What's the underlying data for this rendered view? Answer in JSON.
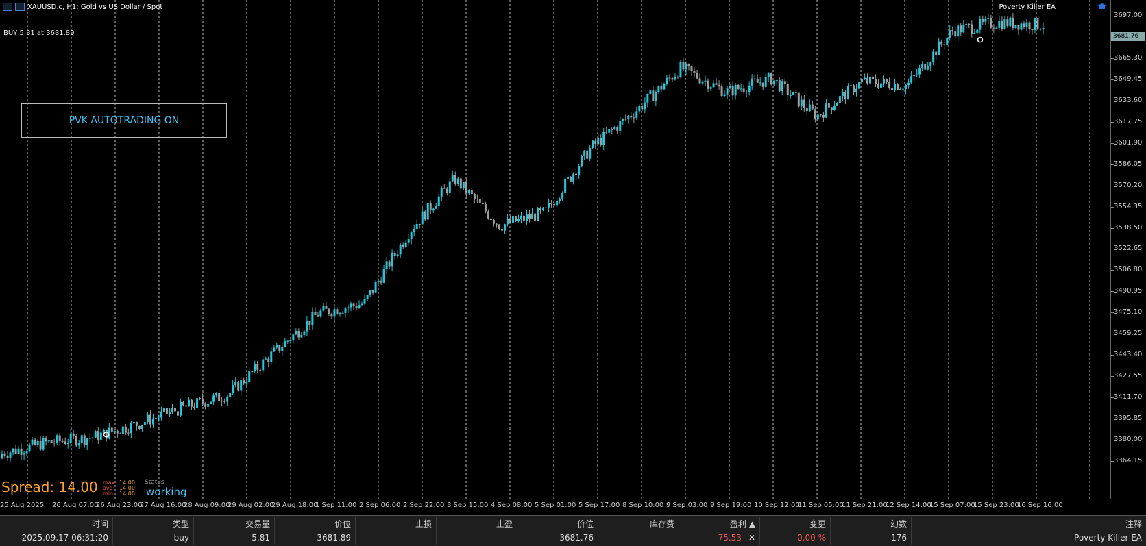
{
  "window": {
    "title": "XAUUSD.c, H1:  Gold vs US Dollar / Spot",
    "ea_name": "Poverty Killer EA"
  },
  "position_line": {
    "label": "BUY 5.81 at 3681.89"
  },
  "panel": {
    "autotrading": "PVK AUTOTRADING ON"
  },
  "current_price": "3681.76",
  "spread": {
    "label": "Spread: 14.00",
    "max_label": "max:",
    "max_value": "14.00",
    "avg_label": "avg:",
    "avg_value": "14.00",
    "min_label": "min:",
    "min_value": "14.00",
    "status_label": "Status",
    "status_value": "working"
  },
  "price_axis": [
    "3697.00",
    "3681.76",
    "3665.30",
    "3649.45",
    "3633.60",
    "3617.75",
    "3601.90",
    "3586.05",
    "3570.20",
    "3554.35",
    "3538.50",
    "3522.65",
    "3506.80",
    "3490.95",
    "3475.10",
    "3459.25",
    "3443.40",
    "3427.55",
    "3411.70",
    "3395.85",
    "3380.00",
    "3364.15"
  ],
  "time_axis": [
    "25 Aug 2025",
    "26 Aug 07:00",
    "26 Aug 23:00",
    "27 Aug 16:00",
    "28 Aug 09:00",
    "29 Aug 02:00",
    "29 Aug 18:00",
    "1 Sep 11:00",
    "2 Sep 06:00",
    "2 Sep 22:00",
    "3 Sep 15:00",
    "4 Sep 08:00",
    "5 Sep 01:00",
    "5 Sep 17:00",
    "8 Sep 10:00",
    "9 Sep 03:00",
    "9 Sep 19:00",
    "10 Sep 12:00",
    "11 Sep 05:00",
    "11 Sep 21:00",
    "12 Sep 14:00",
    "15 Sep 07:00",
    "15 Sep 23:00",
    "16 Sep 16:00"
  ],
  "colors": {
    "bull": "#26c6da",
    "bear": "#9e9e9e",
    "accent": "#3fc4f5",
    "spread": "#f7a12b"
  },
  "table": {
    "headers": [
      "时间",
      "类型",
      "交易量",
      "价位",
      "止损",
      "止盈",
      "价位",
      "库存费",
      "盈利",
      "变更",
      "幻数",
      "注释"
    ],
    "row": {
      "time": "2025.09.17 06:31:20",
      "type": "buy",
      "volume": "5.81",
      "open_price": "3681.89",
      "sl": "",
      "tp": "",
      "price": "3681.76",
      "swap": "",
      "profit": "-75.53",
      "change": "-0.00 %",
      "magic": "176",
      "comment": "Poverty Killer EA"
    }
  },
  "chart_data": {
    "type": "candlestick",
    "symbol": "XAUUSD.c",
    "timeframe": "H1",
    "x": [
      "25 Aug 2025",
      "26 Aug 07:00",
      "26 Aug 23:00",
      "27 Aug 16:00",
      "28 Aug 09:00",
      "29 Aug 02:00",
      "29 Aug 18:00",
      "1 Sep 11:00",
      "2 Sep 06:00",
      "2 Sep 22:00",
      "3 Sep 15:00",
      "4 Sep 08:00",
      "5 Sep 01:00",
      "5 Sep 17:00",
      "8 Sep 10:00",
      "9 Sep 03:00",
      "9 Sep 19:00",
      "10 Sep 12:00",
      "11 Sep 05:00",
      "11 Sep 21:00",
      "12 Sep 14:00",
      "15 Sep 07:00",
      "15 Sep 23:00",
      "16 Sep 16:00"
    ],
    "close": [
      3370,
      3378,
      3382,
      3392,
      3404,
      3414,
      3445,
      3475,
      3482,
      3536,
      3575,
      3540,
      3550,
      3598,
      3626,
      3658,
      3640,
      3650,
      3622,
      3648,
      3645,
      3686,
      3692,
      3690
    ],
    "ylim": [
      3355,
      3705
    ],
    "grid": "vertical dashed"
  }
}
